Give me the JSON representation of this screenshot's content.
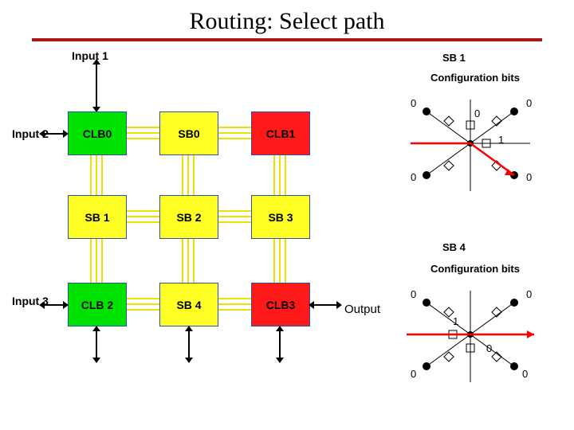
{
  "title": "Routing: Select path",
  "labels": {
    "input1": "Input 1",
    "input2": "Input 2",
    "input3": "Input 3",
    "output": "Output",
    "sb1_title": "SB 1",
    "sb4_title": "SB 4",
    "config_bits": "Configuration bits"
  },
  "blocks": {
    "clb0": "CLB0",
    "sb0": "SB0",
    "clb1": "CLB1",
    "sb1": "SB 1",
    "sb2": "SB 2",
    "sb3": "SB 3",
    "clb2": "CLB 2",
    "sb4": "SB 4",
    "clb3": "CLB3"
  },
  "sb1_bits": {
    "top_left": "0",
    "top_center": "0",
    "top_right": "0",
    "mid_right": "1",
    "bot_left": "0",
    "bot_right": "0"
  },
  "sb4_bits": {
    "top_left": "0",
    "top_right": "0",
    "mid_center": "1",
    "mid_right": "0",
    "bot_left": "0",
    "bot_right": "0"
  },
  "chart_data": {
    "type": "diagram",
    "description": "FPGA routing fabric: 3x3 array of CLBs and Switch Boxes with detail of SB1 and SB4 pass-transistor configuration bits",
    "grid": [
      [
        "CLB0",
        "SB0",
        "CLB1"
      ],
      [
        "SB1",
        "SB2",
        "SB3"
      ],
      [
        "CLB2",
        "SB4",
        "CLB3"
      ]
    ],
    "inputs": [
      "Input1 -> CLB0 top",
      "Input2 -> CLB0 left",
      "Input3 -> CLB2 left"
    ],
    "outputs": [
      "CLB3 right -> Output"
    ],
    "switch_boxes": {
      "SB1": {
        "NW": 0,
        "N": 0,
        "NE": 0,
        "E": 1,
        "SW": 0,
        "SE": 0,
        "selected_path": "left-to-right"
      },
      "SB4": {
        "NW": 0,
        "NE": 0,
        "center": 1,
        "E": 0,
        "SW": 0,
        "SE": 0,
        "selected_path": "left-to-right-through"
      }
    }
  }
}
